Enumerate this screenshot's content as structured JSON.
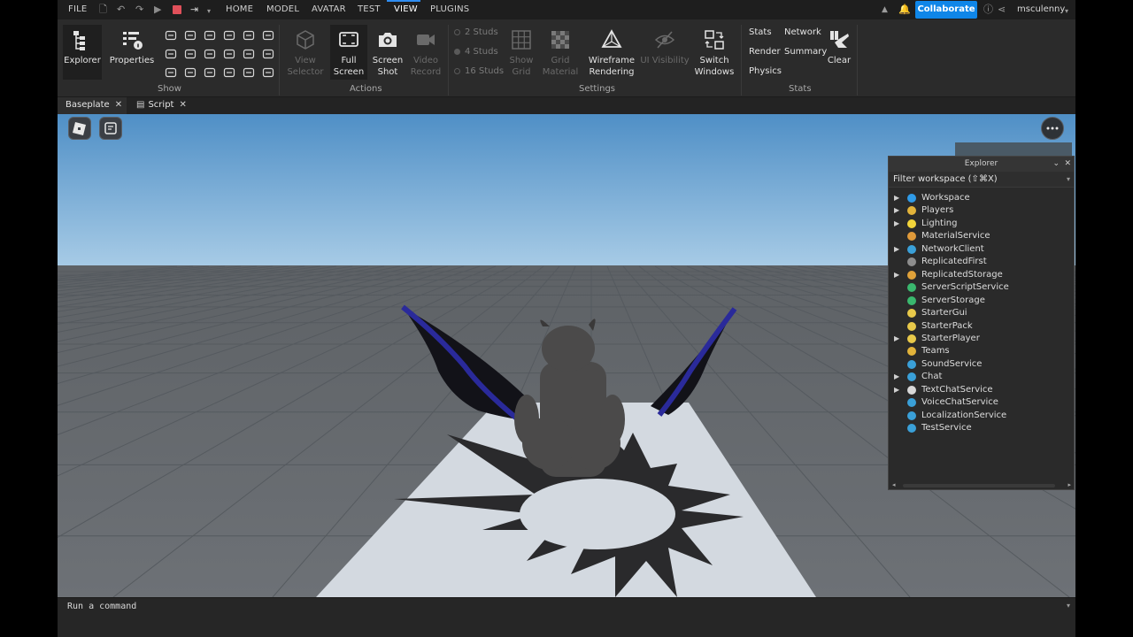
{
  "menubar": {
    "file": "FILE",
    "tabs": [
      "HOME",
      "MODEL",
      "AVATAR",
      "TEST",
      "VIEW",
      "PLUGINS"
    ],
    "active_tab": "VIEW",
    "collaborate": "Collaborate",
    "user": "msculenny"
  },
  "ribbon": {
    "explorer": "Explorer",
    "properties": "Properties",
    "show_group": "Show",
    "view_selector": [
      "View",
      "Selector"
    ],
    "full_screen": [
      "Full",
      "Screen"
    ],
    "screen_shot": [
      "Screen",
      "Shot"
    ],
    "video_record": [
      "Video",
      "Record"
    ],
    "actions_group": "Actions",
    "studs": [
      "2 Studs",
      "4 Studs",
      "16 Studs"
    ],
    "show_grid": [
      "Show",
      "Grid"
    ],
    "grid_material": [
      "Grid",
      "Material"
    ],
    "wireframe": [
      "Wireframe",
      "Rendering"
    ],
    "ui_visibility": "UI Visibility",
    "switch_windows": [
      "Switch",
      "Windows"
    ],
    "settings_group": "Settings",
    "stats": "Stats",
    "network": "Network",
    "render": "Render",
    "summary": "Summary",
    "physics": "Physics",
    "clear": "Clear",
    "stats_group": "Stats"
  },
  "tabs": {
    "baseplate": "Baseplate",
    "script": "Script"
  },
  "explorer": {
    "title": "Explorer",
    "filter": "Filter workspace (⇧⌘X)",
    "items": [
      {
        "label": "Workspace",
        "expand": true,
        "icon": "globe-icon",
        "color": "#2f9be8"
      },
      {
        "label": "Players",
        "expand": true,
        "icon": "players-icon",
        "color": "#e2b33a"
      },
      {
        "label": "Lighting",
        "expand": true,
        "icon": "bulb-icon",
        "color": "#f2d43a"
      },
      {
        "label": "MaterialService",
        "expand": false,
        "icon": "material-icon",
        "color": "#e09a3a"
      },
      {
        "label": "NetworkClient",
        "expand": true,
        "icon": "network-icon",
        "color": "#3aa0d8"
      },
      {
        "label": "ReplicatedFirst",
        "expand": false,
        "icon": "replicated-first-icon",
        "color": "#8d8d8d"
      },
      {
        "label": "ReplicatedStorage",
        "expand": true,
        "icon": "storage-icon",
        "color": "#e0a23a"
      },
      {
        "label": "ServerScriptService",
        "expand": false,
        "icon": "server-script-icon",
        "color": "#3ab86e"
      },
      {
        "label": "ServerStorage",
        "expand": false,
        "icon": "server-storage-icon",
        "color": "#3ab86e"
      },
      {
        "label": "StarterGui",
        "expand": false,
        "icon": "starter-gui-icon",
        "color": "#e8c94a"
      },
      {
        "label": "StarterPack",
        "expand": false,
        "icon": "starter-pack-icon",
        "color": "#e8c94a"
      },
      {
        "label": "StarterPlayer",
        "expand": true,
        "icon": "starter-player-icon",
        "color": "#e8c94a"
      },
      {
        "label": "Teams",
        "expand": false,
        "icon": "teams-icon",
        "color": "#e2b33a"
      },
      {
        "label": "SoundService",
        "expand": false,
        "icon": "sound-icon",
        "color": "#3aa0d8"
      },
      {
        "label": "Chat",
        "expand": true,
        "icon": "chat-icon",
        "color": "#3aa0d8"
      },
      {
        "label": "TextChatService",
        "expand": true,
        "icon": "text-chat-icon",
        "color": "#d8d8d8"
      },
      {
        "label": "VoiceChatService",
        "expand": false,
        "icon": "voice-chat-icon",
        "color": "#3aa0d8"
      },
      {
        "label": "LocalizationService",
        "expand": false,
        "icon": "localization-icon",
        "color": "#3aa0d8"
      },
      {
        "label": "TestService",
        "expand": false,
        "icon": "test-icon",
        "color": "#3aa0d8"
      }
    ]
  },
  "command": {
    "placeholder": "Run a command"
  }
}
